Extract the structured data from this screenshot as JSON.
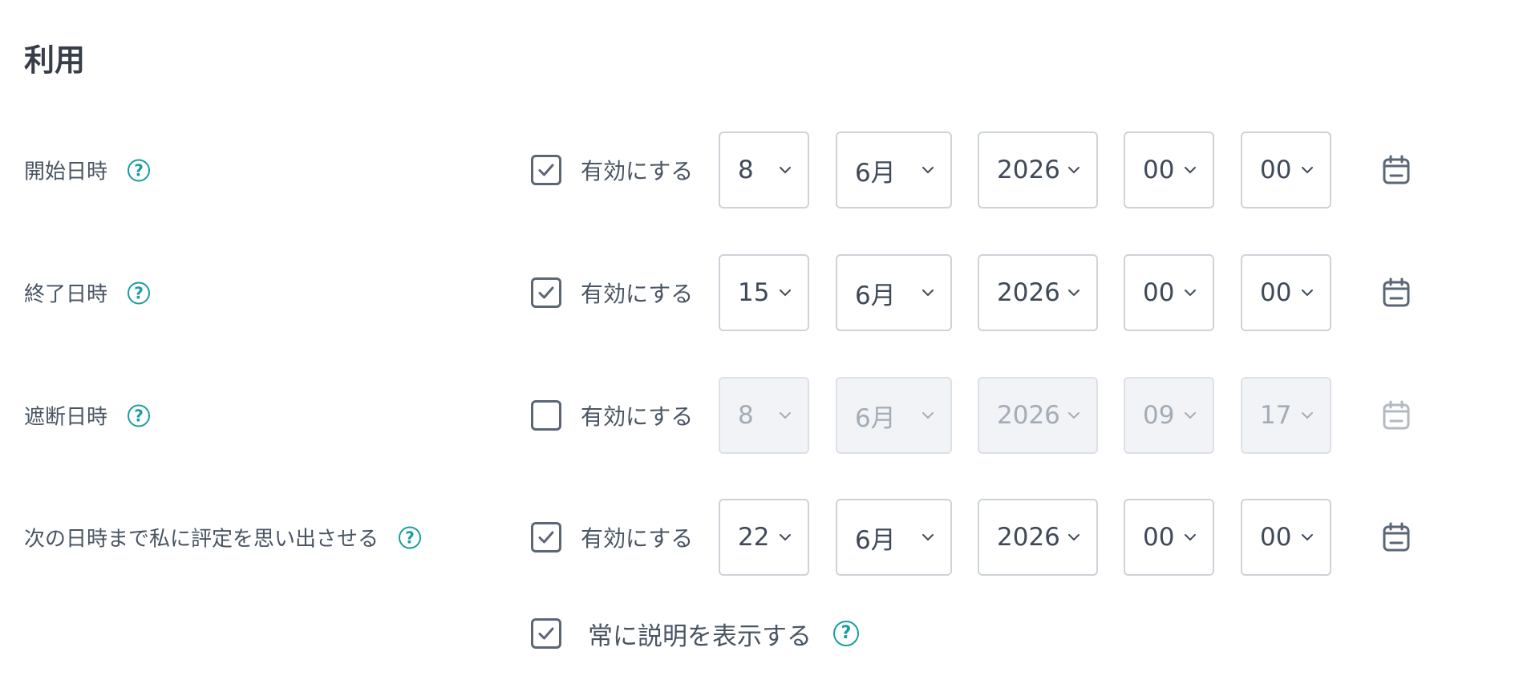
{
  "section": {
    "title": "利用"
  },
  "help_glyph": "?",
  "rows": [
    {
      "label": "開始日時",
      "checked": true,
      "enable_label": "有効にする",
      "disabled": false,
      "day": "8",
      "month": "6月",
      "year": "2026",
      "hour": "00",
      "minute": "00"
    },
    {
      "label": "終了日時",
      "checked": true,
      "enable_label": "有効にする",
      "disabled": false,
      "day": "15",
      "month": "6月",
      "year": "2026",
      "hour": "00",
      "minute": "00"
    },
    {
      "label": "遮断日時",
      "checked": false,
      "enable_label": "有効にする",
      "disabled": true,
      "day": "8",
      "month": "6月",
      "year": "2026",
      "hour": "09",
      "minute": "17"
    },
    {
      "label": "次の日時まで私に評定を思い出させる",
      "checked": true,
      "enable_label": "有効にする",
      "disabled": false,
      "day": "22",
      "month": "6月",
      "year": "2026",
      "hour": "00",
      "minute": "00"
    }
  ],
  "always_show": {
    "label": "常に説明を表示する",
    "checked": true
  },
  "icons": {
    "help": "question-circle-icon",
    "calendar": "calendar-icon",
    "check": "checkmark-icon",
    "chevron": "chevron-down-icon"
  },
  "colors": {
    "accent": "#1b9da2",
    "text": "#495563",
    "border": "#ced3d9",
    "disabled_bg": "#f1f3f7",
    "disabled_text": "#a4acb6"
  }
}
